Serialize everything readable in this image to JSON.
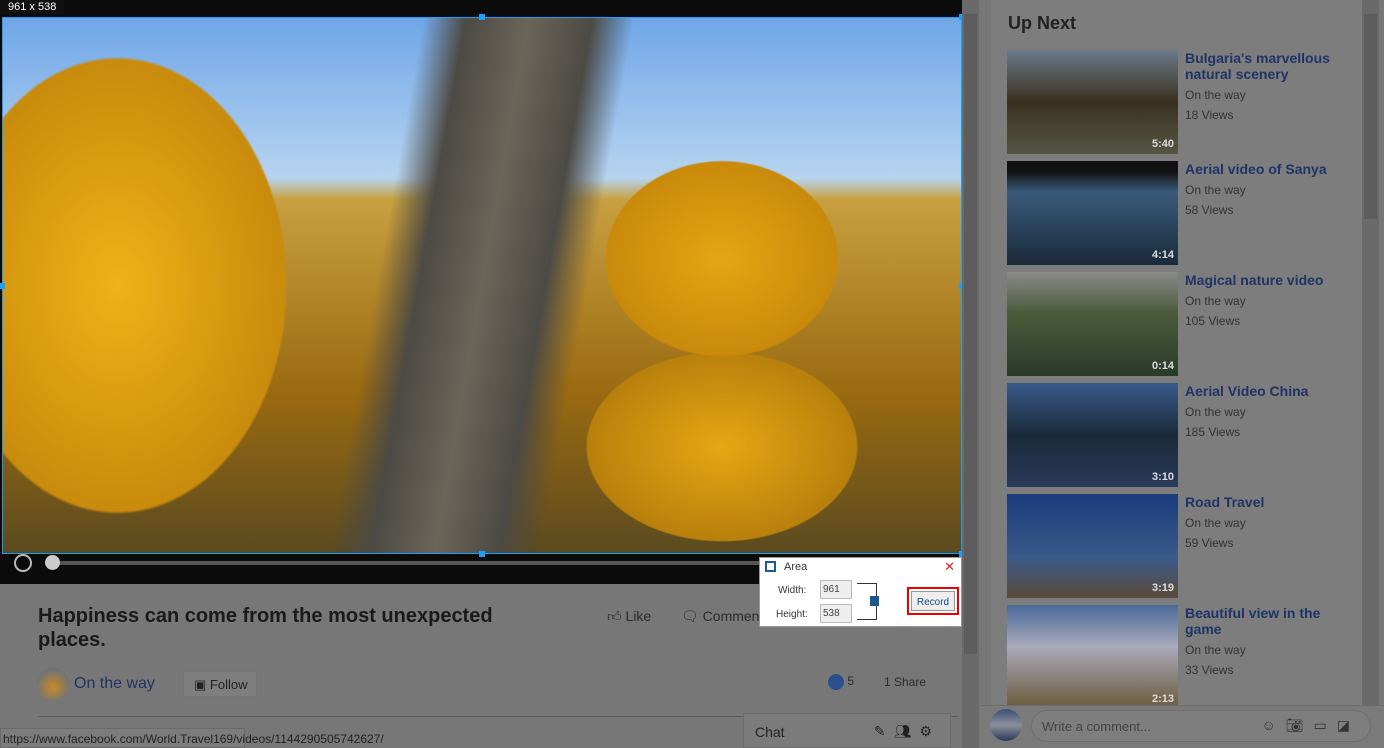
{
  "overlay": {
    "size_label": "961 x 538"
  },
  "area_dialog": {
    "title": "Area",
    "width_label": "Width:",
    "height_label": "Height:",
    "width": "961",
    "height": "538",
    "record": "Record",
    "close": "✕"
  },
  "post": {
    "title": "Happiness can come from the most unexpected places.",
    "like": "Like",
    "comment": "Comment",
    "author": "On the way",
    "follow": "Follow",
    "likes": "5",
    "shares": "1 Share"
  },
  "status_url": "https://www.facebook.com/World.Travel169/videos/1144290505742627/",
  "chat": {
    "label": "Chat"
  },
  "up_next": {
    "heading": "Up Next",
    "items": [
      {
        "title": "Bulgaria's marvellous natural scenery",
        "channel": "On the way",
        "views": "18 Views",
        "duration": "5:40"
      },
      {
        "title": "Aerial video of Sanya",
        "channel": "On the way",
        "views": "58 Views",
        "duration": "4:14"
      },
      {
        "title": "Magical nature video",
        "channel": "On the way",
        "views": "105 Views",
        "duration": "0:14"
      },
      {
        "title": "Aerial Video China",
        "channel": "On the way",
        "views": "185 Views",
        "duration": "3:10"
      },
      {
        "title": "Road Travel",
        "channel": "On the way",
        "views": "59 Views",
        "duration": "3:19"
      },
      {
        "title": "Beautiful view in the game",
        "channel": "On the way",
        "views": "33 Views",
        "duration": "2:13"
      }
    ]
  },
  "comment": {
    "placeholder": "Write a comment..."
  },
  "colors": {
    "selection": "#19a0ff",
    "link": "#1f3466",
    "record_highlight": "#e00000"
  }
}
